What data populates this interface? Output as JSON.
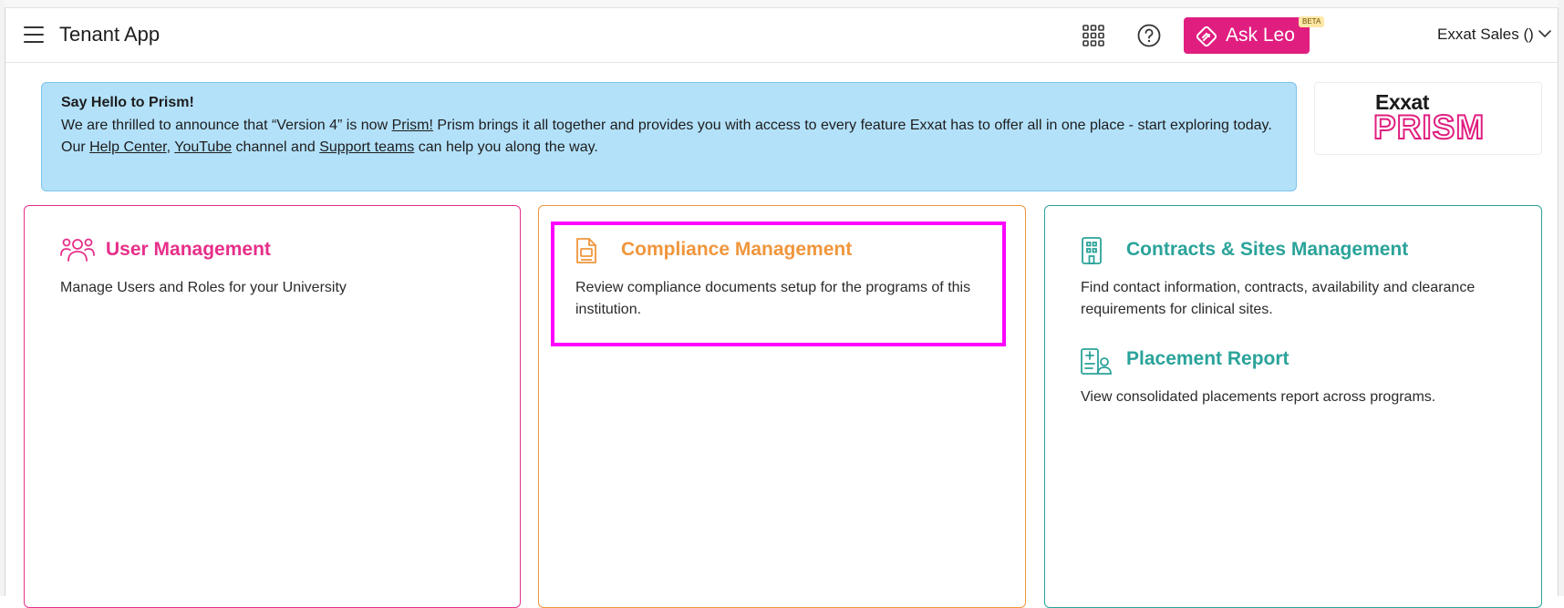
{
  "header": {
    "app_title": "Tenant App",
    "ask_leo_label": "Ask Leo",
    "beta_badge": "BETA",
    "user_name": "Exxat Sales ()"
  },
  "banner": {
    "title": "Say Hello to Prism!",
    "line1_pre": "We are thrilled to announce that “Version 4” is now ",
    "line1_link": "Prism!",
    "line1_post": " Prism brings it all together and provides you with access to every feature Exxat has to offer all in one place - start exploring today.",
    "line2_pre": "Our ",
    "line2_link_help": "Help Center",
    "line2_sep": ", ",
    "line2_link_youtube": "YouTube",
    "line2_mid": " channel and ",
    "line2_link_support": "Support teams",
    "line2_post": " can help you along the way."
  },
  "logo": {
    "line1": "Exxat",
    "line2": "PRISM"
  },
  "cards": {
    "user_management": {
      "title": "User Management",
      "description": "Manage Users and Roles for your University"
    },
    "compliance_management": {
      "title": "Compliance Management",
      "description_line1": "Review compliance documents setup for the programs of this",
      "description_line2": "institution."
    },
    "contracts_sites": {
      "title": "Contracts & Sites Management",
      "description_line1": "Find contact information, contracts, availability and clearance",
      "description_line2": "requirements for clinical sites."
    },
    "placement_report": {
      "title": "Placement Report",
      "description": "View consolidated placements report across programs."
    }
  },
  "colors": {
    "brand_pink": "#e01e80",
    "user_card": "#e62f8a",
    "compliance_card": "#f0963c",
    "contracts_card": "#2aa39a",
    "banner_bg": "#b3e1fa",
    "highlight": "#ff00ff"
  },
  "icons": {
    "menu": "hamburger-icon",
    "apps": "grid-apps-icon",
    "help": "question-circle-icon",
    "leo": "leo-diamond-icon",
    "chevron": "chevron-down-icon",
    "users": "users-group-icon",
    "compliance": "document-icon",
    "contracts": "building-icon",
    "placement": "clipboard-user-icon"
  }
}
